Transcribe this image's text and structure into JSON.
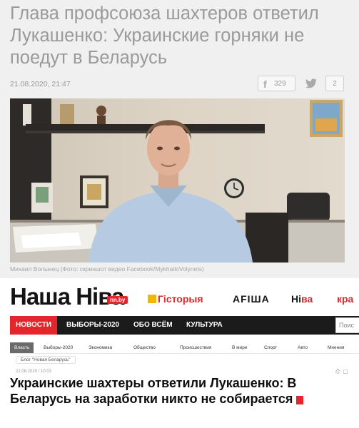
{
  "top_article": {
    "title": "Глава профсоюза шахтеров ответил Лукашенко: Украинские горняки не поедут в Беларусь",
    "date": "21.08.2020, 21:47",
    "facebook_count": "329",
    "comments_count": "2",
    "photo_caption": "Михаил Волынец (Фото: скриншот видео Facebook/MykhailoVolynets)",
    "icons": [
      "facebook-icon",
      "twitter-icon",
      "comment-icon"
    ]
  },
  "site": {
    "brand": "Наша Ніва",
    "brand_domain": "nn.by",
    "top_links": {
      "history": "Гісторыя",
      "afisha": "AFIША",
      "niva_a": "Ні",
      "niva_b": "ва",
      "kra": "кра"
    },
    "nav": [
      "НОВОСТИ",
      "ВЫБОРЫ-2020",
      "ОБО ВСЁМ",
      "КУЛЬТУРА"
    ],
    "search_placeholder": "Поис",
    "subnav": [
      "Власть",
      "Выборы-2020",
      "Экономика",
      "Общество",
      "Происшествия",
      "В мире",
      "Спорт",
      "Авто",
      "Мнения"
    ],
    "tag": "Блог \"Новая Беларусь\"",
    "meta_date": "22.08.2020 / 10:03",
    "headline": "Украинские шахтеры ответили Лукашенко: В Беларусь на заработки никто не собирается"
  },
  "colors": {
    "brand_red": "#e3262c",
    "nav_dark": "#1b1b1b",
    "history_yellow": "#f2b705"
  }
}
